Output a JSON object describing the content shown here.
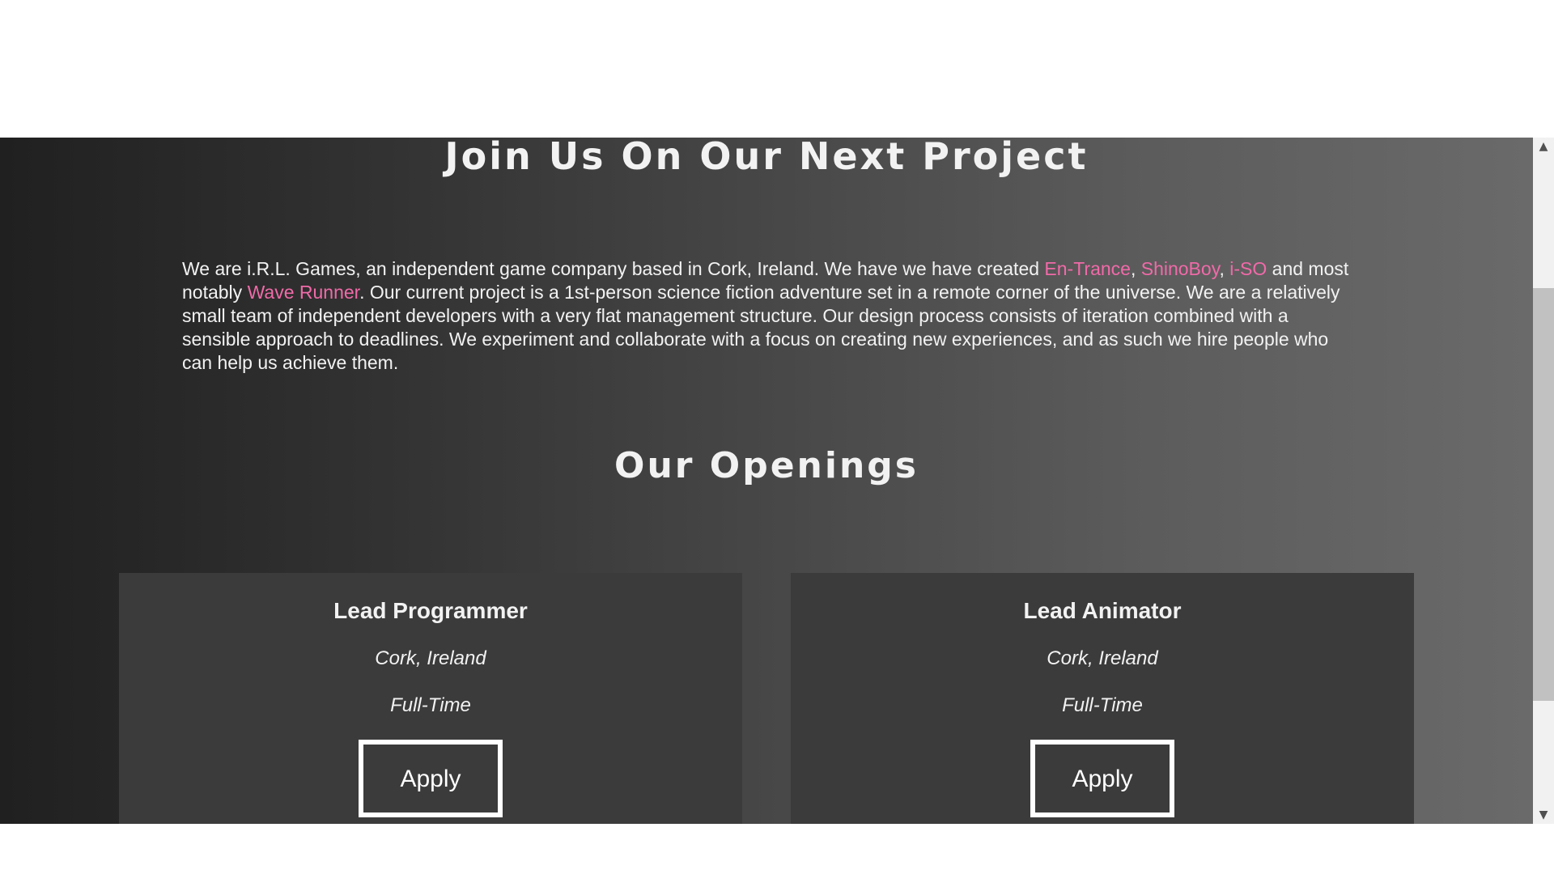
{
  "main": {
    "heading": "Join Us On Our Next Project",
    "intro": {
      "part1": "We are i.R.L. Games, an independent game company based in Cork, Ireland. We have we have created ",
      "game1": "En-Trance",
      "sep1": ", ",
      "game2": "ShinoBoy",
      "sep2": ", ",
      "game3": "i-SO",
      "part2": " and most notably ",
      "game4": "Wave Runner",
      "part3": ". Our current project is a 1st-person science fiction adventure set in a remote corner of the universe. We are a relatively small team of independent developers with a very flat management structure. Our design process consists of iteration combined with a sensible approach to deadlines. We experiment and collaborate with a focus on creating new experiences, and as such we hire people who can help us achieve them."
    },
    "link_color": "#f06aa8",
    "openings_heading": "Our Openings"
  },
  "openings": [
    {
      "title": "Lead Programmer",
      "location": "Cork, Ireland",
      "type": "Full-Time",
      "apply_label": "Apply"
    },
    {
      "title": "Lead Animator",
      "location": "Cork, Ireland",
      "type": "Full-Time",
      "apply_label": "Apply"
    }
  ],
  "scrollbar": {
    "up_icon": "chevron-up-icon",
    "down_icon": "chevron-down-icon"
  }
}
